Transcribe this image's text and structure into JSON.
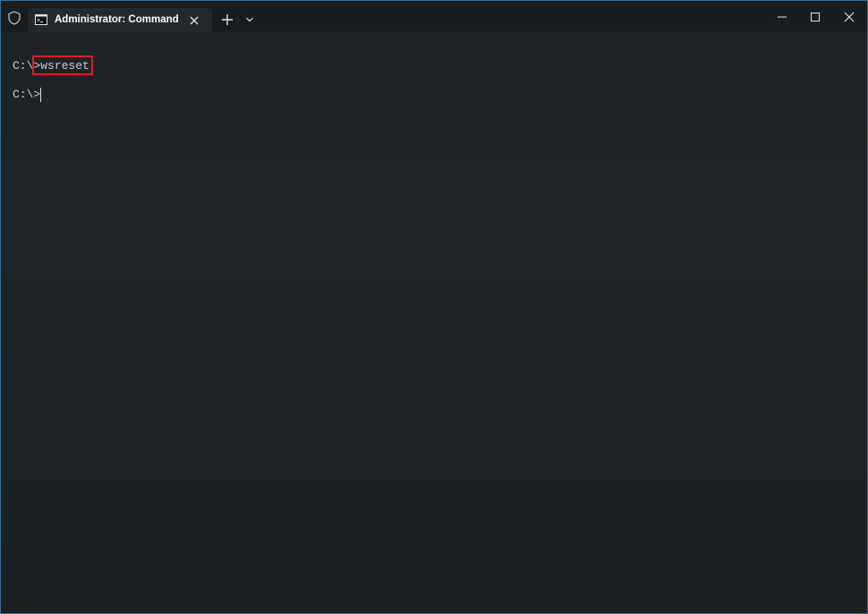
{
  "titlebar": {
    "tab_title": "Administrator: Command Prompt",
    "icons": {
      "shield": "shield-icon",
      "tab": "command-prompt-icon",
      "close_tab": "close-icon",
      "new_tab": "plus-icon",
      "dropdown": "chevron-down-icon",
      "minimize": "minimize-icon",
      "maximize": "maximize-icon",
      "close_window": "close-icon"
    }
  },
  "terminal": {
    "lines": [
      {
        "prompt": "C:\\>",
        "command": "wsreset"
      },
      {
        "prompt": "C:\\>",
        "command": ""
      }
    ],
    "highlight_color": "#e01b24",
    "text_color": "#cccccc"
  }
}
